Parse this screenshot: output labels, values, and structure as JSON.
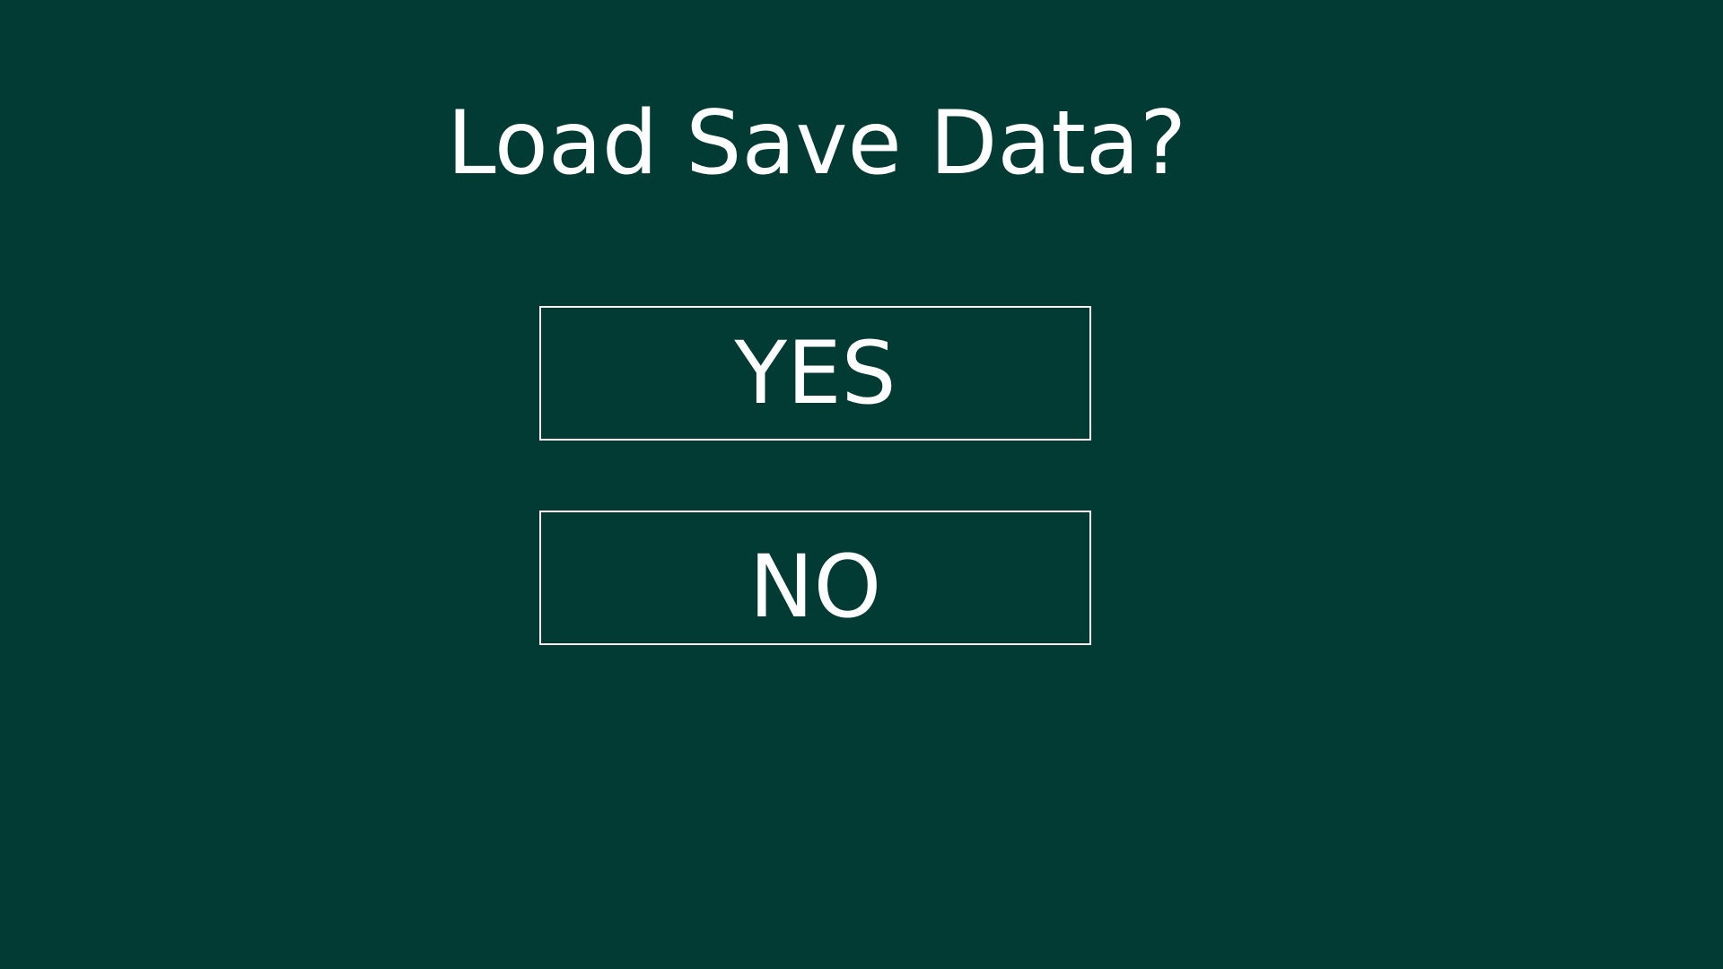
{
  "dialog": {
    "title": "Load Save Data?",
    "yes_label": "YES",
    "no_label": "NO"
  },
  "colors": {
    "background": "#013B33",
    "foreground": "#FFFFFF"
  }
}
